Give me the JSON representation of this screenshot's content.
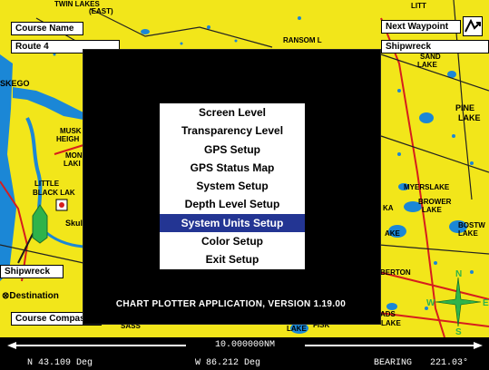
{
  "course_name": {
    "label": "Course Name",
    "value": "Route 4"
  },
  "next_waypoint": {
    "label": "Next Waypoint",
    "value": "Shipwreck"
  },
  "map_labels": {
    "twin_lakes": "TWIN LAKES",
    "east": "(EAST)",
    "ransom": "RANSOM L",
    "sand_lake_1": "SAND",
    "sand_lake_2": "LAKE",
    "pine_lake_1": "PINE",
    "pine_lake_2": "LAKE",
    "muskegon": "SKEGO",
    "musk": "MUSK",
    "height": "HEIGH",
    "mon": "MON",
    "lak": "LAKI",
    "little": "LITTLE",
    "black_lake": "BLACK LAK",
    "skul": "Skul",
    "shipwreck": "Shipwreck",
    "destination": "Destination",
    "course_compass": "Course Compass",
    "kay": "KA",
    "myers": "MYERSLAKE",
    "brower_1": "BROWER",
    "brower_2": "LAKE",
    "bostw_1": "BOSTW",
    "bostw_2": "LAKE",
    "ake": "AKE",
    "berton": "BERTON",
    "sass": "SASS",
    "lake_small": "LAKE",
    "fisk": "FISK",
    "lake_br": "LAKE",
    "ads": "ADS",
    "litt": "LITT"
  },
  "compass": {
    "n": "N",
    "s": "S",
    "e": "E",
    "w": "W"
  },
  "menu": {
    "items": [
      "Screen Level",
      "Transparency Level",
      "GPS Setup",
      "GPS Status Map",
      "System Setup",
      "Depth Level Setup",
      "System Units Setup",
      "Color Setup",
      "Exit Setup"
    ],
    "selected_index": 6
  },
  "version_text": "CHART PLOTTER APPLICATION, VERSION 1.19.00",
  "scale": "10.000000NM",
  "status": {
    "latitude": "N 43.109 Deg",
    "longitude": "W 86.212 Deg",
    "bearing_label": "BEARING",
    "bearing_value": "221.03°"
  },
  "colors": {
    "land": "#f2e61a",
    "water": "#1b87d6",
    "menu_highlight": "#233593",
    "boat": "#2fb34a"
  }
}
